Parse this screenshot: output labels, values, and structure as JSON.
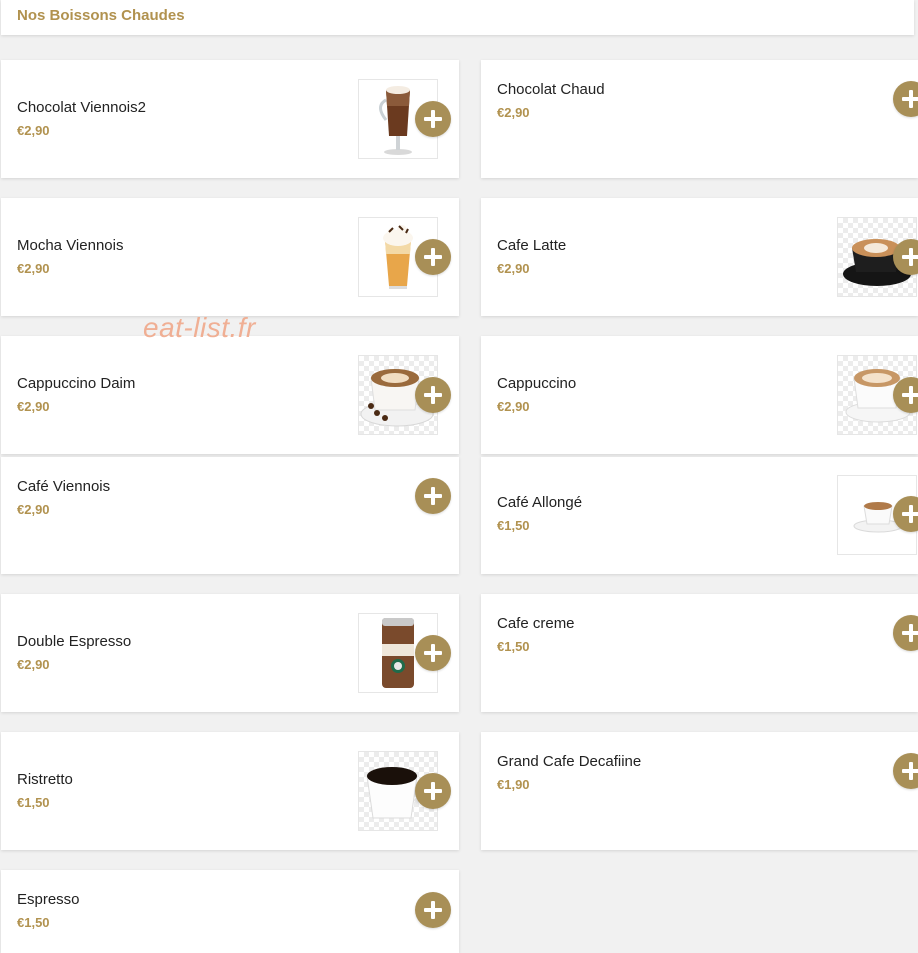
{
  "section": {
    "title": "Nos Boissons Chaudes"
  },
  "watermark": "eat-list.fr",
  "items": [
    {
      "name": "Chocolat Viennois2",
      "price": "€2,90",
      "image": "hot-chocolate-glass-image"
    },
    {
      "name": "Chocolat Chaud",
      "price": "€2,90",
      "image": null
    },
    {
      "name": "Mocha Viennois",
      "price": "€2,90",
      "image": "mocha-glass-image"
    },
    {
      "name": "Cafe Latte",
      "price": "€2,90",
      "image": "latte-cup-image"
    },
    {
      "name": "Cappuccino Daim",
      "price": "€2,90",
      "image": "cappuccino-daim-image"
    },
    {
      "name": "Cappuccino",
      "price": "€2,90",
      "image": "cappuccino-cup-image"
    },
    {
      "name": "Café Viennois",
      "price": "€2,90",
      "image": null
    },
    {
      "name": "Café Allongé",
      "price": "€1,50",
      "image": "small-coffee-cup-image"
    },
    {
      "name": "Double Espresso",
      "price": "€2,90",
      "image": "doubleshot-can-image"
    },
    {
      "name": "Cafe creme",
      "price": "€1,50",
      "image": null
    },
    {
      "name": "Ristretto",
      "price": "€1,50",
      "image": "black-coffee-cup-image"
    },
    {
      "name": "Grand Cafe Decafiine",
      "price": "€1,90",
      "image": null
    },
    {
      "name": "Espresso",
      "price": "€1,50",
      "image": null
    }
  ],
  "colors": {
    "accent": "#b1924f",
    "add_button": "#a88f57",
    "background": "#f1f1f1",
    "card": "#ffffff",
    "watermark": "#f0a88a"
  },
  "icons": {
    "add": "plus-circle-icon"
  }
}
